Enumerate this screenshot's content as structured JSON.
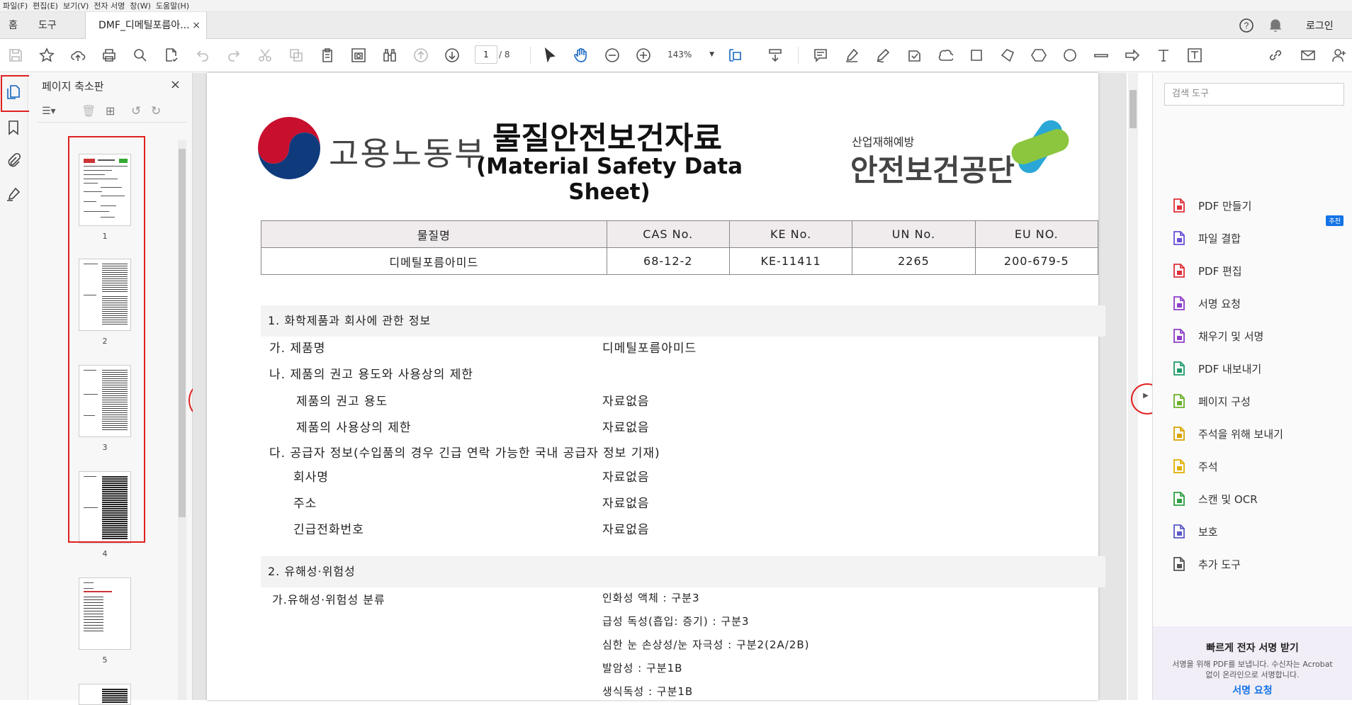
{
  "menu": [
    "파일(F)",
    "편집(E)",
    "보기(V)",
    "전자 서명",
    "창(W)",
    "도움말(H)"
  ],
  "tabs": {
    "home": "홈",
    "tools": "도구",
    "doc": "DMF_디메틸포름아...",
    "close": "×"
  },
  "account": {
    "login": "로그인"
  },
  "toolbar": {
    "page_current": "1",
    "page_total": "/ 8",
    "zoom": "143%"
  },
  "thumbnails": {
    "title": "페이지 축소판",
    "close": "×",
    "pages": [
      "1",
      "2",
      "3",
      "4",
      "5"
    ]
  },
  "search": {
    "placeholder": "검색 도구"
  },
  "tools": [
    {
      "label": "PDF 만들기",
      "icon": "create-pdf-icon",
      "color": "#e0303a"
    },
    {
      "label": "파일 결합",
      "icon": "combine-files-icon",
      "color": "#6b4fd8"
    },
    {
      "label": "PDF 편집",
      "icon": "edit-pdf-icon",
      "color": "#e0303a"
    },
    {
      "label": "서명 요청",
      "icon": "request-signature-icon",
      "color": "#8e3ec9"
    },
    {
      "label": "채우기 및 서명",
      "icon": "fill-sign-icon",
      "color": "#8e3ec9"
    },
    {
      "label": "PDF 내보내기",
      "icon": "export-pdf-icon",
      "color": "#1e9c6a"
    },
    {
      "label": "페이지 구성",
      "icon": "organize-pages-icon",
      "color": "#6ab029"
    },
    {
      "label": "주석을 위해 보내기",
      "icon": "send-comments-icon",
      "color": "#d9a400"
    },
    {
      "label": "주석",
      "icon": "comment-icon",
      "color": "#e0b000"
    },
    {
      "label": "스캔 및 OCR",
      "icon": "scan-ocr-icon",
      "color": "#2ea043"
    },
    {
      "label": "보호",
      "icon": "protect-icon",
      "color": "#5a58c8"
    },
    {
      "label": "추가 도구",
      "icon": "more-tools-icon",
      "color": "#555555"
    }
  ],
  "badge": "추천",
  "promo": {
    "title": "빠르게 전자 서명 받기",
    "body": "서명을 위해 PDF를 보냅니다. 수신자는 Acrobat 없이 온라인으로 서명합니다.",
    "link": "서명 요청"
  },
  "doc": {
    "ministry": "고용노동부",
    "title_ko": "물질안전보건자료",
    "title_en": "(Material Safety Data Sheet)",
    "agency_small": "산업재해예방",
    "agency": "안전보건공단",
    "id_headers": [
      "물질명",
      "CAS No.",
      "KE No.",
      "UN No.",
      "EU NO."
    ],
    "id_values": [
      "디메틸포름아미드",
      "68-12-2",
      "KE-11411",
      "2265",
      "200-679-5"
    ],
    "section1": "1. 화학제품과 회사에 관한 정보",
    "s1_rows": [
      {
        "label": "가. 제품명",
        "value": "디메틸포름아미드"
      },
      {
        "label": "나. 제품의 권고 용도와 사용상의 제한",
        "value": ""
      },
      {
        "label": "제품의 권고 용도",
        "value": "자료없음"
      },
      {
        "label": "제품의 사용상의 제한",
        "value": "자료없음"
      },
      {
        "label": "다. 공급자 정보(수입품의 경우 긴급 연락 가능한 국내 공급자 정보 기재)",
        "value": ""
      },
      {
        "label": "회사명",
        "value": "자료없음"
      },
      {
        "label": "주소",
        "value": "자료없음"
      },
      {
        "label": "긴급전화번호",
        "value": "자료없음"
      }
    ],
    "section2": "2. 유해성·위험성",
    "s2_label": "가.유해성·위험성 분류",
    "s2_values": [
      "인화성 액체 : 구분3",
      "급성 독성(흡입: 증기) : 구분3",
      "심한 눈 손상성/눈 자극성 : 구분2(2A/2B)",
      "발암성 : 구분1B",
      "생식독성 : 구분1B"
    ]
  }
}
